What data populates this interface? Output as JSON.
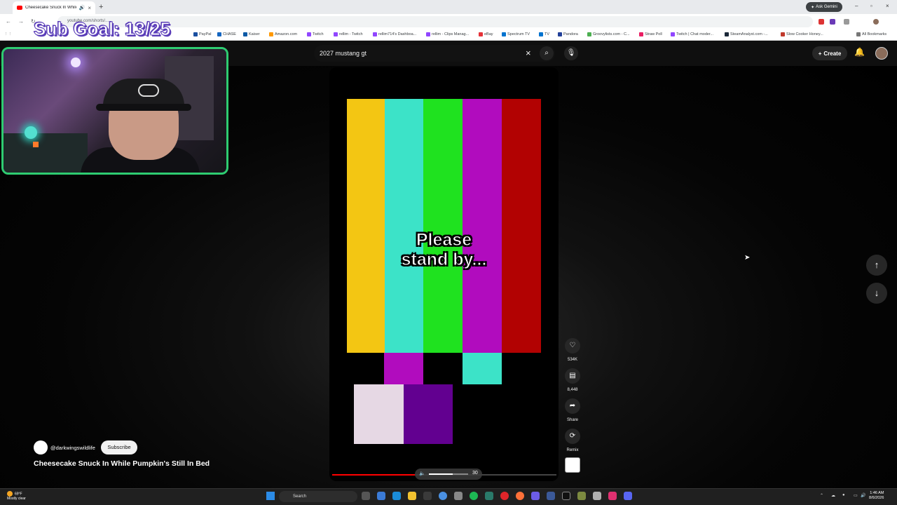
{
  "browser": {
    "tab_title": "Cheesecake Snuck In While",
    "url": "youtube.com/shorts/...",
    "gemini_label": "Ask Gemini",
    "bookmarks": [
      "PayPal",
      "CHASE",
      "Kaiser",
      "Amazon.com",
      "Twitch",
      "rellim - Twitch",
      "rellim714's Dashboa...",
      "rellim - Clips Manag...",
      "eBay",
      "Spectrum TV",
      "TV",
      "Pandora",
      "Groovylists.com - C...",
      "Straw Poll",
      "Twitch | Chat moder...",
      "SteamAnalyst.com -...",
      "Slow Cooker Honey..."
    ],
    "all_bookmarks": "All Bookmarks"
  },
  "overlay": {
    "sub_goal": "Sub Goal: 13/25"
  },
  "youtube": {
    "search_query": "2027 mustang gt",
    "create_label": "Create"
  },
  "player": {
    "caption_line1": "Please",
    "caption_line2": "stand by...",
    "progress_fraction": 0.37,
    "volume_value": "30",
    "volume_fraction": 0.6
  },
  "actions": {
    "likes": "534K",
    "comments": "8,448",
    "share": "Share",
    "remix": "Remix"
  },
  "channel": {
    "handle": "@darkwingswildlife",
    "subscribe": "Subscribe",
    "video_title": "Cheesecake Snuck In While Pumpkin's Still In Bed"
  },
  "taskbar": {
    "temp": "69°F",
    "weather": "Mostly clear",
    "search": "Search",
    "time": "1:46 AM",
    "date": "8/6/2026"
  },
  "colors": {
    "bars": [
      "#f3c613",
      "#3ce3c8",
      "#1fe21f",
      "#b10cbe",
      "#b20202"
    ],
    "youtube_red": "#ff0000"
  }
}
